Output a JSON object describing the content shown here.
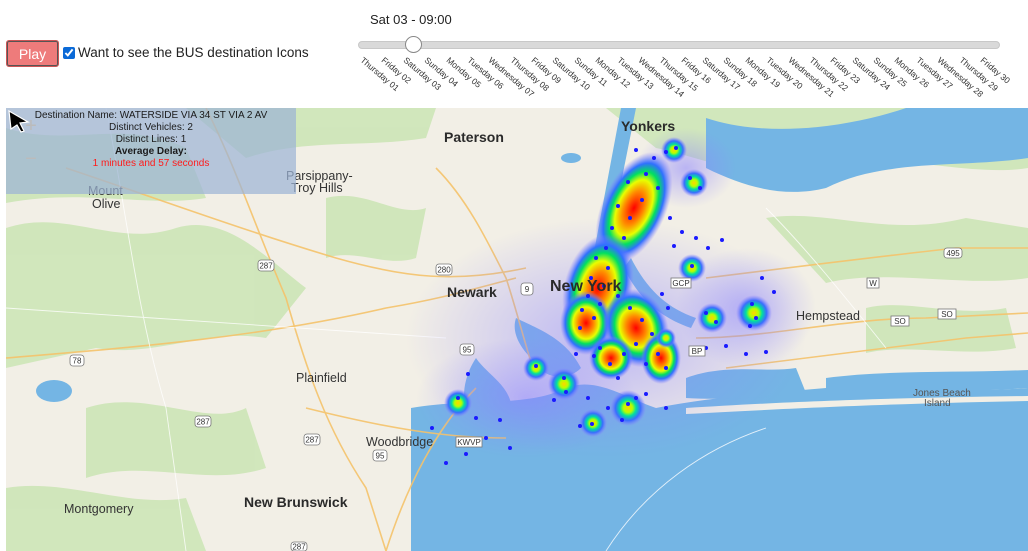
{
  "controls": {
    "play_label": "Play",
    "bus_icons_label": "Want to see the BUS destination Icons",
    "bus_icons_checked": true,
    "current_time": "Sat 03 - 09:00",
    "days": [
      "Thursday 01",
      "Friday 02",
      "Saturday 03",
      "Sunday 04",
      "Monday 05",
      "Tuesday 06",
      "Wednesday 07",
      "Thursday 08",
      "Friday 09",
      "Saturday 10",
      "Sunday 11",
      "Monday 12",
      "Tuesday 13",
      "Wednesday 14",
      "Thursday 15",
      "Friday 16",
      "Saturday 17",
      "Sunday 18",
      "Monday 19",
      "Tuesday 20",
      "Wednesday 21",
      "Thursday 22",
      "Friday 23",
      "Saturday 24",
      "Sunday 25",
      "Monday 26",
      "Tuesday 27",
      "Wednesday 28",
      "Thursday 29",
      "Friday 30"
    ],
    "slider_position": 0.085
  },
  "info": {
    "destination": "Destination Name: WATERSIDE VIA 34 ST VIA 2 AV",
    "vehicles": "Distinct Vehicles: 2",
    "lines": "Distinct Lines: 1",
    "avg_label": "Average Delay:",
    "avg_value": "1 minutes and 57 seconds"
  },
  "zoom": {
    "in": "+",
    "out": "−"
  },
  "places": {
    "yonkers": "Yonkers",
    "paterson": "Paterson",
    "parsippany": "Parsippany-",
    "troy_hills": "Troy Hills",
    "mount_olive_1": "Mount",
    "mount_olive_2": "Olive",
    "newark": "Newark",
    "new_york": "New York",
    "hempstead": "Hempstead",
    "plainfield": "Plainfield",
    "woodbridge": "Woodbridge",
    "new_brunswick": "New Brunswick",
    "montgomery": "Montgomery",
    "jones_beach": "Jones Beach",
    "island": "Island"
  },
  "shields": {
    "i287a": "287",
    "i280": "280",
    "i9": "9",
    "i95a": "95",
    "i78": "78",
    "i287b": "287",
    "i287c": "287",
    "i95b": "95",
    "kwvp": "KWVP",
    "gcp": "GCP",
    "bp": "BP",
    "i495": "495",
    "so1": "SO",
    "so2": "SO",
    "w": "W",
    "i287d": "287"
  },
  "colors": {
    "water": "#74b5e4",
    "land": "#f2efe6",
    "park": "#c9e3b4",
    "play_button": "#ee7b7b",
    "bus_dot": "#1a1aff",
    "delay_text": "#ff1a1a"
  }
}
